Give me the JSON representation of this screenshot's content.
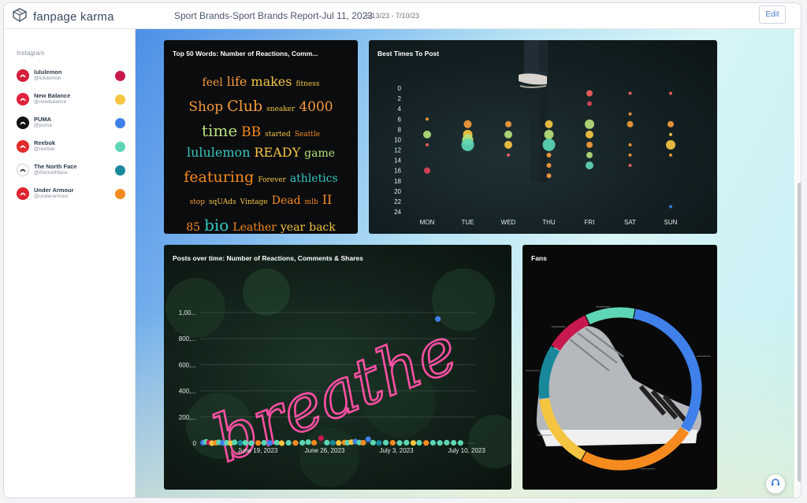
{
  "header": {
    "logo_text": "fanpage karma",
    "report_title": "Sport Brands-Sport Brands Report-Jul 11, 2023",
    "date_range": "6/13/23 - 7/10/23",
    "edit_label": "Edit"
  },
  "sidebar": {
    "heading": "Instagram",
    "profiles": [
      {
        "name": "lululemon",
        "handle": "@lululemon",
        "color": "#c8194f",
        "icon_bg": "#d31f3a",
        "icon": "lululemon-logo-icon"
      },
      {
        "name": "New Balance",
        "handle": "@newbalance",
        "color": "#f5c542",
        "icon_bg": "#e2213a",
        "icon": "new-balance-logo-icon"
      },
      {
        "name": "PUMA",
        "handle": "@puma",
        "color": "#3f80ea",
        "icon_bg": "#111111",
        "icon": "puma-logo-icon"
      },
      {
        "name": "Reebok",
        "handle": "@reebok",
        "color": "#5dd6b5",
        "icon_bg": "#e02b2b",
        "icon": "reebok-logo-icon"
      },
      {
        "name": "The North Face",
        "handle": "@thenorthface",
        "color": "#19889a",
        "icon_bg": "#ffffff",
        "icon": "north-face-logo-icon"
      },
      {
        "name": "Under Armour",
        "handle": "@underarmour",
        "color": "#f58a1f",
        "icon_bg": "#e0242f",
        "icon": "under-armour-logo-icon"
      }
    ]
  },
  "cards": {
    "words": {
      "title": "Top 50 Words: Number of Reactions, Comm...",
      "lines": [
        [
          {
            "t": "feel",
            "s": 14,
            "c": "#f59b3b"
          },
          {
            "t": "life",
            "s": 16,
            "c": "#f59b3b"
          },
          {
            "t": "makes",
            "s": 16,
            "c": "#f5c542"
          },
          {
            "t": "fitness",
            "s": 9,
            "c": "#f5c542"
          }
        ],
        [
          {
            "t": "Shop",
            "s": 17,
            "c": "#f59b3b"
          },
          {
            "t": "Club",
            "s": 19,
            "c": "#f59b3b"
          },
          {
            "t": "sneaker",
            "s": 9,
            "c": "#f5c542"
          },
          {
            "t": "4000",
            "s": 17,
            "c": "#f59b3b"
          }
        ],
        [
          {
            "t": "time",
            "s": 20,
            "c": "#b6e07a"
          },
          {
            "t": "BB",
            "s": 17,
            "c": "#f58a1f"
          },
          {
            "t": "started",
            "s": 9,
            "c": "#f5c542"
          },
          {
            "t": "Seattle",
            "s": 9,
            "c": "#f58a1f"
          }
        ],
        [
          {
            "t": "lululemon",
            "s": 16,
            "c": "#38c7c2"
          },
          {
            "t": "READY",
            "s": 16,
            "c": "#f5c542"
          },
          {
            "t": "game",
            "s": 14,
            "c": "#b6e07a"
          }
        ],
        [
          {
            "t": "featuring",
            "s": 19,
            "c": "#f58a1f"
          },
          {
            "t": "Forever",
            "s": 9,
            "c": "#f5c542"
          },
          {
            "t": "athletics",
            "s": 14,
            "c": "#38c7c2"
          }
        ],
        [
          {
            "t": "stop",
            "s": 9,
            "c": "#f59b3b"
          },
          {
            "t": "sqUAds",
            "s": 9,
            "c": "#f5c542"
          },
          {
            "t": "Vintage",
            "s": 9,
            "c": "#f5c542"
          },
          {
            "t": "Dead",
            "s": 14,
            "c": "#f58a1f"
          },
          {
            "t": "mlb",
            "s": 9,
            "c": "#f58a1f"
          },
          {
            "t": "II",
            "s": 16,
            "c": "#f58a1f"
          }
        ],
        [
          {
            "t": "85",
            "s": 14,
            "c": "#f58a1f"
          },
          {
            "t": "bio",
            "s": 20,
            "c": "#38c7c2"
          },
          {
            "t": "Leather",
            "s": 14,
            "c": "#f58a1f"
          },
          {
            "t": "year",
            "s": 14,
            "c": "#f5c542"
          },
          {
            "t": "back",
            "s": 14,
            "c": "#f5c542"
          }
        ]
      ]
    },
    "times": {
      "title": "Best Times To Post"
    },
    "posts": {
      "title": "Posts over time: Number of Reactions, Comments & Shares",
      "neon_text": "breathe"
    },
    "fans": {
      "title": "Fans"
    }
  },
  "chart_data": [
    {
      "type": "scatter",
      "title": "Best Times To Post",
      "categories": [
        "MON",
        "TUE",
        "WED",
        "THU",
        "FRI",
        "SAT",
        "SUN"
      ],
      "y_ticks": [
        0,
        2,
        4,
        6,
        8,
        10,
        12,
        14,
        16,
        18,
        20,
        22,
        24
      ],
      "ylim": [
        0,
        24
      ],
      "points": [
        {
          "day": "MON",
          "hour": 6,
          "size": 2,
          "color": "#f59b3b"
        },
        {
          "day": "MON",
          "hour": 9,
          "size": 5,
          "color": "#b6e07a"
        },
        {
          "day": "MON",
          "hour": 11,
          "size": 2,
          "color": "#f55f5f"
        },
        {
          "day": "MON",
          "hour": 16,
          "size": 4,
          "color": "#e0455a"
        },
        {
          "day": "TUE",
          "hour": 7,
          "size": 5,
          "color": "#f59b3b"
        },
        {
          "day": "TUE",
          "hour": 9,
          "size": 6,
          "color": "#f5c542"
        },
        {
          "day": "TUE",
          "hour": 10,
          "size": 7,
          "color": "#b6e07a"
        },
        {
          "day": "TUE",
          "hour": 11,
          "size": 8,
          "color": "#5dd6b5"
        },
        {
          "day": "WED",
          "hour": 7,
          "size": 4,
          "color": "#f59b3b"
        },
        {
          "day": "WED",
          "hour": 9,
          "size": 5,
          "color": "#b6e07a"
        },
        {
          "day": "WED",
          "hour": 11,
          "size": 5,
          "color": "#f5c542"
        },
        {
          "day": "WED",
          "hour": 13,
          "size": 2,
          "color": "#f55f5f"
        },
        {
          "day": "THU",
          "hour": 7,
          "size": 5,
          "color": "#f5c542"
        },
        {
          "day": "THU",
          "hour": 9,
          "size": 6,
          "color": "#b6e07a"
        },
        {
          "day": "THU",
          "hour": 11,
          "size": 8,
          "color": "#5dd6b5"
        },
        {
          "day": "THU",
          "hour": 13,
          "size": 3,
          "color": "#f59b3b"
        },
        {
          "day": "THU",
          "hour": 15,
          "size": 3,
          "color": "#f59b3b"
        },
        {
          "day": "THU",
          "hour": 17,
          "size": 3,
          "color": "#f59b3b"
        },
        {
          "day": "FRI",
          "hour": 1,
          "size": 4,
          "color": "#f55f5f"
        },
        {
          "day": "FRI",
          "hour": 3,
          "size": 3,
          "color": "#e0455a"
        },
        {
          "day": "FRI",
          "hour": 7,
          "size": 6,
          "color": "#b6e07a"
        },
        {
          "day": "FRI",
          "hour": 9,
          "size": 5,
          "color": "#f5c542"
        },
        {
          "day": "FRI",
          "hour": 11,
          "size": 4,
          "color": "#f59b3b"
        },
        {
          "day": "FRI",
          "hour": 13,
          "size": 4,
          "color": "#b6e07a"
        },
        {
          "day": "FRI",
          "hour": 15,
          "size": 5,
          "color": "#5dd6b5"
        },
        {
          "day": "SAT",
          "hour": 1,
          "size": 2,
          "color": "#f55f5f"
        },
        {
          "day": "SAT",
          "hour": 5,
          "size": 2,
          "color": "#f59b3b"
        },
        {
          "day": "SAT",
          "hour": 7,
          "size": 4,
          "color": "#f59b3b"
        },
        {
          "day": "SAT",
          "hour": 11,
          "size": 2,
          "color": "#f59b3b"
        },
        {
          "day": "SAT",
          "hour": 13,
          "size": 2,
          "color": "#f59b3b"
        },
        {
          "day": "SAT",
          "hour": 15,
          "size": 2,
          "color": "#f55f5f"
        },
        {
          "day": "SUN",
          "hour": 1,
          "size": 2,
          "color": "#f55f5f"
        },
        {
          "day": "SUN",
          "hour": 7,
          "size": 4,
          "color": "#f59b3b"
        },
        {
          "day": "SUN",
          "hour": 9,
          "size": 2,
          "color": "#f5c542"
        },
        {
          "day": "SUN",
          "hour": 11,
          "size": 6,
          "color": "#f5c542"
        },
        {
          "day": "SUN",
          "hour": 13,
          "size": 2,
          "color": "#f59b3b"
        },
        {
          "day": "SUN",
          "hour": 23,
          "size": 2,
          "color": "#3f80ea"
        }
      ]
    },
    {
      "type": "scatter",
      "title": "Posts over time: Number of Reactions, Comments & Shares",
      "x_ticks": [
        "June 19, 2023",
        "June 26, 2023",
        "July 3, 2023",
        "July 10, 2023"
      ],
      "y_ticks": [
        "0",
        "200,...",
        "400,...",
        "600,...",
        "800,...",
        "1,00..."
      ],
      "ylim": [
        0,
        1000000
      ],
      "xlim_days": [
        0,
        28
      ],
      "points": [
        {
          "d": 0.3,
          "v": 4000,
          "c": "#3f80ea"
        },
        {
          "d": 0.6,
          "v": 10000,
          "c": "#5dd6b5"
        },
        {
          "d": 0.9,
          "v": 5000,
          "c": "#c8194f"
        },
        {
          "d": 1.2,
          "v": 0,
          "c": "#f5c542"
        },
        {
          "d": 1.6,
          "v": 3000,
          "c": "#f58a1f"
        },
        {
          "d": 1.9,
          "v": 6000,
          "c": "#5dd6b5"
        },
        {
          "d": 2.3,
          "v": 2000,
          "c": "#3f80ea"
        },
        {
          "d": 2.7,
          "v": 3000,
          "c": "#5dd6b5"
        },
        {
          "d": 3.1,
          "v": 0,
          "c": "#f5c542"
        },
        {
          "d": 3.5,
          "v": 6000,
          "c": "#5dd6b5"
        },
        {
          "d": 4.1,
          "v": 2000,
          "c": "#19889a"
        },
        {
          "d": 4.6,
          "v": 3000,
          "c": "#5dd6b5"
        },
        {
          "d": 5.2,
          "v": 0,
          "c": "#5dd6b5"
        },
        {
          "d": 5.9,
          "v": 2000,
          "c": "#f58a1f"
        },
        {
          "d": 6.5,
          "v": 3000,
          "c": "#5dd6b5"
        },
        {
          "d": 7.1,
          "v": 2000,
          "c": "#3f80ea"
        },
        {
          "d": 7.8,
          "v": 4000,
          "c": "#5dd6b5"
        },
        {
          "d": 8.3,
          "v": 0,
          "c": "#f5c542"
        },
        {
          "d": 9.0,
          "v": 3000,
          "c": "#5dd6b5"
        },
        {
          "d": 9.7,
          "v": 2000,
          "c": "#f58a1f"
        },
        {
          "d": 10.4,
          "v": 3000,
          "c": "#5dd6b5"
        },
        {
          "d": 11.0,
          "v": 8000,
          "c": "#5dd6b5"
        },
        {
          "d": 11.6,
          "v": 3000,
          "c": "#f58a1f"
        },
        {
          "d": 12.3,
          "v": 38000,
          "c": "#c8194f"
        },
        {
          "d": 12.9,
          "v": 4000,
          "c": "#5dd6b5"
        },
        {
          "d": 13.5,
          "v": 3000,
          "c": "#19889a"
        },
        {
          "d": 14.1,
          "v": 2000,
          "c": "#f5c542"
        },
        {
          "d": 14.7,
          "v": 5000,
          "c": "#f58a1f"
        },
        {
          "d": 15.0,
          "v": 3000,
          "c": "#5dd6b5"
        },
        {
          "d": 15.4,
          "v": 8000,
          "c": "#f5c542"
        },
        {
          "d": 15.8,
          "v": 12000,
          "c": "#3f80ea"
        },
        {
          "d": 16.2,
          "v": 5000,
          "c": "#5dd6b5"
        },
        {
          "d": 16.6,
          "v": 3000,
          "c": "#f58a1f"
        },
        {
          "d": 17.1,
          "v": 30000,
          "c": "#3f80ea"
        },
        {
          "d": 17.6,
          "v": 4000,
          "c": "#5dd6b5"
        },
        {
          "d": 18.2,
          "v": 2000,
          "c": "#19889a"
        },
        {
          "d": 18.9,
          "v": 4000,
          "c": "#5dd6b5"
        },
        {
          "d": 19.6,
          "v": 3000,
          "c": "#f58a1f"
        },
        {
          "d": 20.3,
          "v": 2000,
          "c": "#5dd6b5"
        },
        {
          "d": 21.0,
          "v": 4000,
          "c": "#5dd6b5"
        },
        {
          "d": 21.7,
          "v": 2000,
          "c": "#f5c542"
        },
        {
          "d": 22.3,
          "v": 3000,
          "c": "#5dd6b5"
        },
        {
          "d": 23.0,
          "v": 2000,
          "c": "#f58a1f"
        },
        {
          "d": 23.7,
          "v": 3000,
          "c": "#5dd6b5"
        },
        {
          "d": 24.4,
          "v": 2000,
          "c": "#5dd6b5"
        },
        {
          "d": 25.1,
          "v": 4000,
          "c": "#5dd6b5"
        },
        {
          "d": 25.8,
          "v": 3000,
          "c": "#5dd6b5"
        },
        {
          "d": 26.5,
          "v": 2000,
          "c": "#5dd6b5"
        },
        {
          "d": 24.2,
          "v": 950000,
          "c": "#3f80ea"
        }
      ]
    },
    {
      "type": "pie",
      "title": "Fans",
      "slices": [
        {
          "name": "PUMA",
          "value": 31,
          "color": "#3f80ea"
        },
        {
          "name": "Under Armour",
          "value": 24,
          "color": "#f58a1f"
        },
        {
          "name": "New Balance",
          "value": 15,
          "color": "#f5c542"
        },
        {
          "name": "The North Face",
          "value": 11,
          "color": "#19889a"
        },
        {
          "name": "lululemon",
          "value": 9,
          "color": "#c8194f"
        },
        {
          "name": "Reebok",
          "value": 10,
          "color": "#5dd6b5"
        }
      ]
    }
  ]
}
